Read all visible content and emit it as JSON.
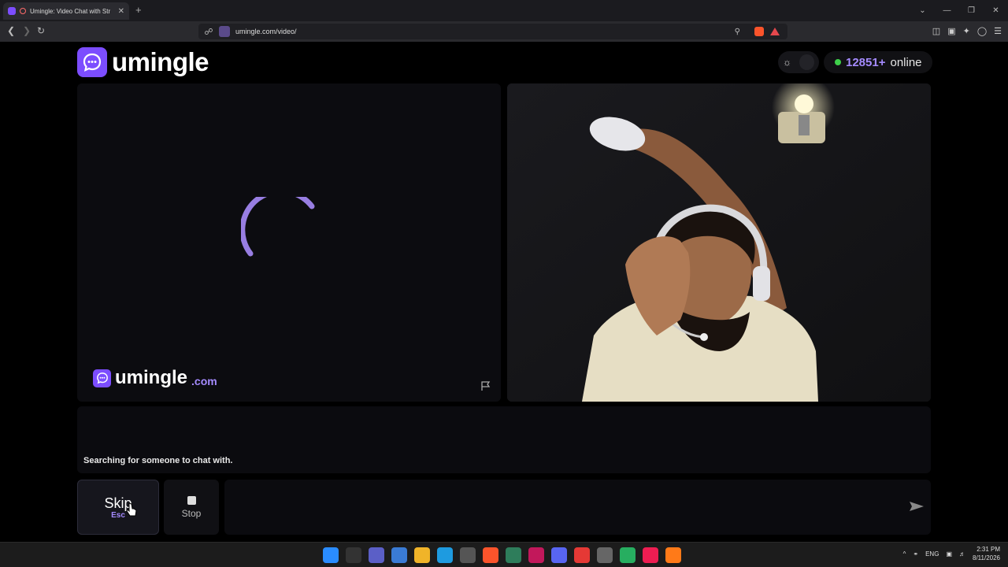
{
  "browser": {
    "tab_title": "Umingle: Video Chat with Str",
    "tab_close": "✕",
    "new_tab": "+",
    "url": "umingle.com/video/",
    "window_controls": [
      "⌄",
      "—",
      "❐",
      "✕"
    ]
  },
  "header": {
    "logo_text": "umingle",
    "online_count": "12851+",
    "online_label": "online"
  },
  "video_left": {
    "watermark_text": "umingle",
    "watermark_suffix": ".com"
  },
  "chat": {
    "status_text": "Searching for someone to chat with.",
    "input_value": ""
  },
  "controls": {
    "skip_label": "Skip",
    "skip_key": "Esc",
    "stop_label": "Stop"
  },
  "taskbar": {
    "lang": "ENG",
    "time": "2:31 PM",
    "date": "8/11/2026"
  },
  "colors": {
    "accent": "#7c4dff",
    "accent_light": "#a58bff",
    "online_green": "#3ecf4a"
  }
}
